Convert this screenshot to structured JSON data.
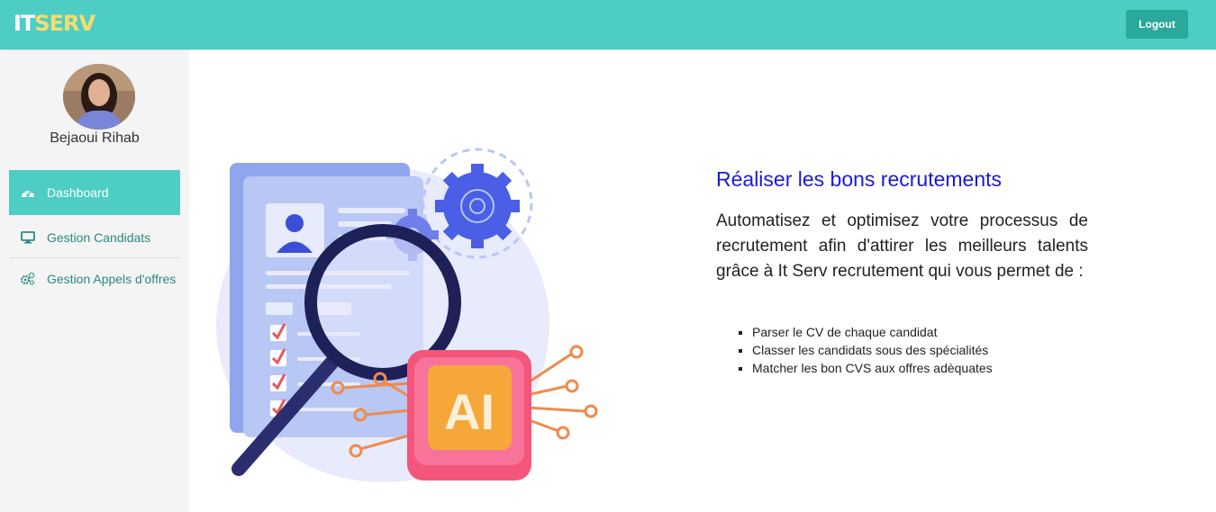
{
  "header": {
    "logo_part1": "IT",
    "logo_part2": "SERV",
    "logout_label": "Logout"
  },
  "user": {
    "name": "Bejaoui Rihab"
  },
  "sidebar": {
    "items": [
      {
        "label": "Dashboard",
        "icon": "dashboard-icon",
        "active": true
      },
      {
        "label": "Gestion Candidats",
        "icon": "desktop-icon",
        "active": false
      },
      {
        "label": "Gestion Appels d'offres",
        "icon": "gears-icon",
        "active": false
      }
    ]
  },
  "main": {
    "title": "Réaliser les bons recrutements",
    "paragraph": "Automatisez et optimisez votre processus de recrutement afin d'attirer les meilleurs talents grâce à It Serv recrutement qui vous permet de :",
    "features": [
      "Parser le CV de chaque candidat",
      "Classer les candidats sous des spécialités",
      "Matcher les bon CVS aux offres adèquates"
    ],
    "illustration_text": "AI"
  },
  "colors": {
    "accent": "#4ecdc4",
    "button": "#2aa89a",
    "title": "#1a1ad6",
    "logo_highlight": "#f7dc6f"
  }
}
